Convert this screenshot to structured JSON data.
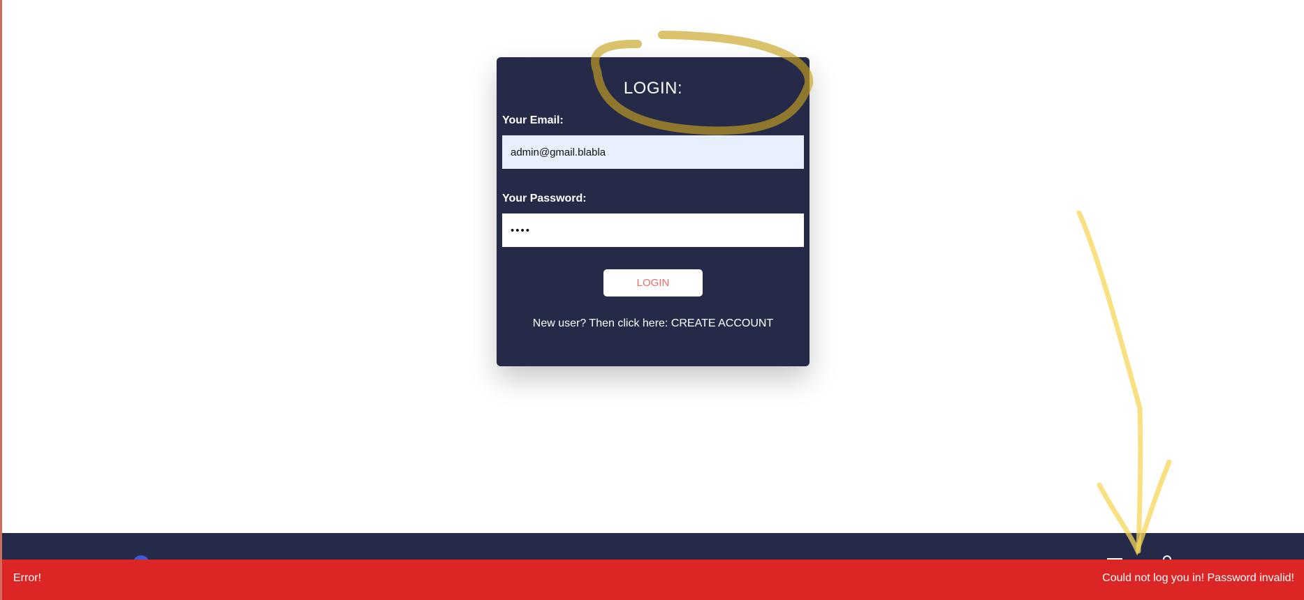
{
  "login_form": {
    "title": "LOGIN:",
    "email_label": "Your Email:",
    "email_value": "admin@gmail.blabla",
    "password_label": "Your Password:",
    "password_value": "abcd",
    "submit_label": "LOGIN",
    "signup_prompt": "New user? Then click here: ",
    "signup_link": "CREATE ACCOUNT"
  },
  "toast": {
    "title": "Error!",
    "message": "Could not log you in! Password invalid!"
  },
  "colors": {
    "card_background": "#252a48",
    "error_background": "#dc2626",
    "login_button_text": "#f06a6a",
    "annotation_highlight": "#f5d55a"
  },
  "icons": [
    "avatar",
    "window-icon",
    "user-icon"
  ]
}
